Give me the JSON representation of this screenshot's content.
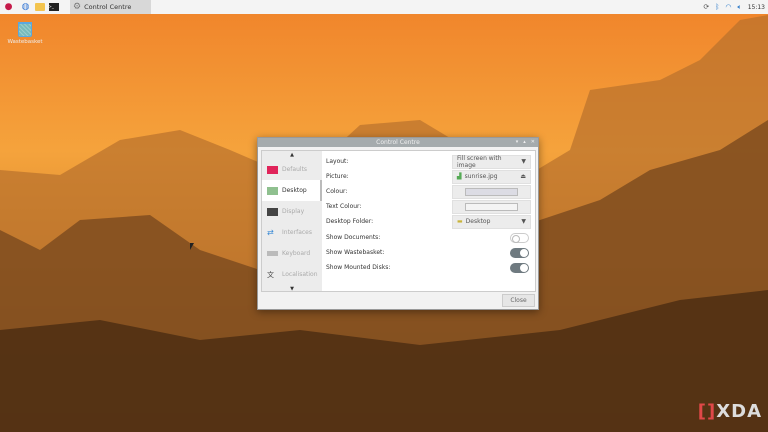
{
  "taskbar": {
    "task_label": "Control Centre",
    "clock": "15:13",
    "icons": [
      "raspberry-icon",
      "browser-icon",
      "folder-icon",
      "terminal-icon"
    ]
  },
  "desktop": {
    "wastebasket_label": "Wastebasket",
    "watermark": "XDA"
  },
  "dialog": {
    "title": "Control Centre",
    "sidebar": [
      {
        "label": "Defaults"
      },
      {
        "label": "Desktop",
        "active": true
      },
      {
        "label": "Display"
      },
      {
        "label": "Interfaces"
      },
      {
        "label": "Keyboard"
      },
      {
        "label": "Localisation"
      }
    ],
    "layout": {
      "label": "Layout:",
      "value": "Fill screen with image"
    },
    "picture": {
      "label": "Picture:",
      "value": "sunrise.jpg"
    },
    "colour": {
      "label": "Colour:",
      "value": "#dcdce4"
    },
    "text_colour": {
      "label": "Text Colour:",
      "value": "#f4f4f4"
    },
    "desktop_folder": {
      "label": "Desktop Folder:",
      "value": "Desktop"
    },
    "show_documents": {
      "label": "Show Documents:",
      "on": false
    },
    "show_wastebasket": {
      "label": "Show Wastebasket:",
      "on": true
    },
    "show_mounted": {
      "label": "Show Mounted Disks:",
      "on": true
    },
    "close_label": "Close"
  }
}
